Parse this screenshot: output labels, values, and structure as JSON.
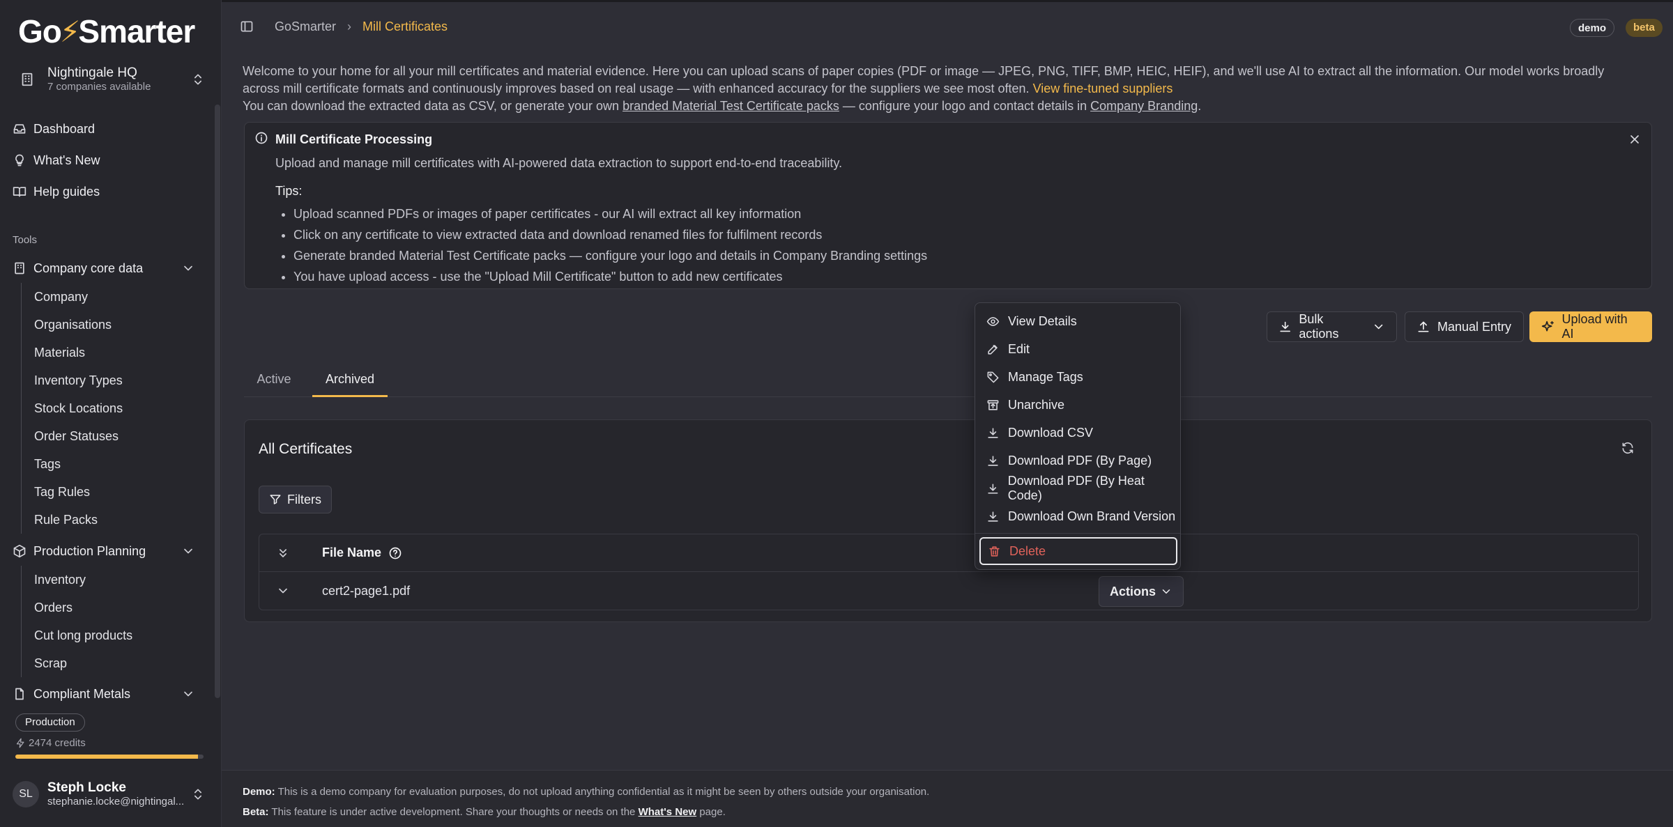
{
  "app": {
    "logo_pre": "Go",
    "logo_bolt": "⚡",
    "logo_post": "Smarter"
  },
  "org": {
    "name": "Nightingale HQ",
    "sub": "7 companies available"
  },
  "nav": {
    "dashboard": "Dashboard",
    "whats_new": "What's New",
    "help": "Help guides",
    "tools_label": "Tools",
    "company_core": "Company core data",
    "core_items": [
      "Company",
      "Organisations",
      "Materials",
      "Inventory Types",
      "Stock Locations",
      "Order Statuses",
      "Tags",
      "Tag Rules",
      "Rule Packs"
    ],
    "production_planning": "Production Planning",
    "prod_items": [
      "Inventory",
      "Orders",
      "Cut long products",
      "Scrap"
    ],
    "compliant_metals": "Compliant Metals"
  },
  "account": {
    "environment": "Production",
    "credits": "2474 credits",
    "credits_fraction": 0.97,
    "initials": "SL",
    "name": "Steph Locke",
    "email": "stephanie.locke@nightingal..."
  },
  "topbar": {
    "crumb_root": "GoSmarter",
    "crumb_sep": "›",
    "crumb_current": "Mill Certificates",
    "tag_demo": "demo",
    "tag_beta": "beta"
  },
  "intro": {
    "p1": "Welcome to your home for all your mill certificates and material evidence. Here you can upload scans of paper copies (PDF or image — JPEG, PNG, TIFF, BMP, HEIC, HEIF), and we'll use AI to extract all the information. Our model works broadly across mill certificate formats and continuously improves based on real usage — with enhanced accuracy for the suppliers we see most often.",
    "p1_link": "View fine-tuned suppliers",
    "p2_a": "You can download the extracted data as CSV, or generate your own",
    "p2_link1": "branded Material Test Certificate packs",
    "p2_b": "— configure your logo and contact details in",
    "p2_link2": "Company Branding",
    "p2_c": "."
  },
  "info": {
    "title": "Mill Certificate Processing",
    "desc": "Upload and manage mill certificates with AI-powered data extraction to support end-to-end traceability.",
    "tips_label": "Tips:",
    "tips": [
      "Upload scanned PDFs or images of paper certificates - our AI will extract all key information",
      "Click on any certificate to view extracted data and download renamed files for fulfilment records",
      "Generate branded Material Test Certificate packs — configure your logo and details in Company Branding settings",
      "You have upload access - use the \"Upload Mill Certificate\" button to add new certificates"
    ]
  },
  "actions": {
    "bulk": "Bulk actions",
    "manual": "Manual Entry",
    "upload": "Upload with AI"
  },
  "tabs": {
    "active": "Active",
    "archived": "Archived"
  },
  "card": {
    "title": "All Certificates",
    "filters": "Filters",
    "col_file": "File Name",
    "rows": [
      {
        "file": "cert2-page1.pdf",
        "actions": "Actions"
      }
    ]
  },
  "menu": {
    "items": [
      "View Details",
      "Edit",
      "Manage Tags",
      "Unarchive",
      "Download CSV",
      "Download PDF (By Page)",
      "Download PDF (By Heat Code)",
      "Download Own Brand Version"
    ],
    "delete": "Delete"
  },
  "footer": {
    "demo_label": "Demo:",
    "demo_text": "This is a demo company for evaluation purposes, do not upload anything confidential as it might be seen by others outside your organisation.",
    "beta_label": "Beta:",
    "beta_text": "This feature is under active development. Share your thoughts or needs on the",
    "beta_link": "What's New",
    "beta_end": "page."
  },
  "colors": {
    "accent": "#f3b94b",
    "danger": "#e0625a",
    "background": "#2e2e36",
    "sidebar": "#26262c"
  }
}
